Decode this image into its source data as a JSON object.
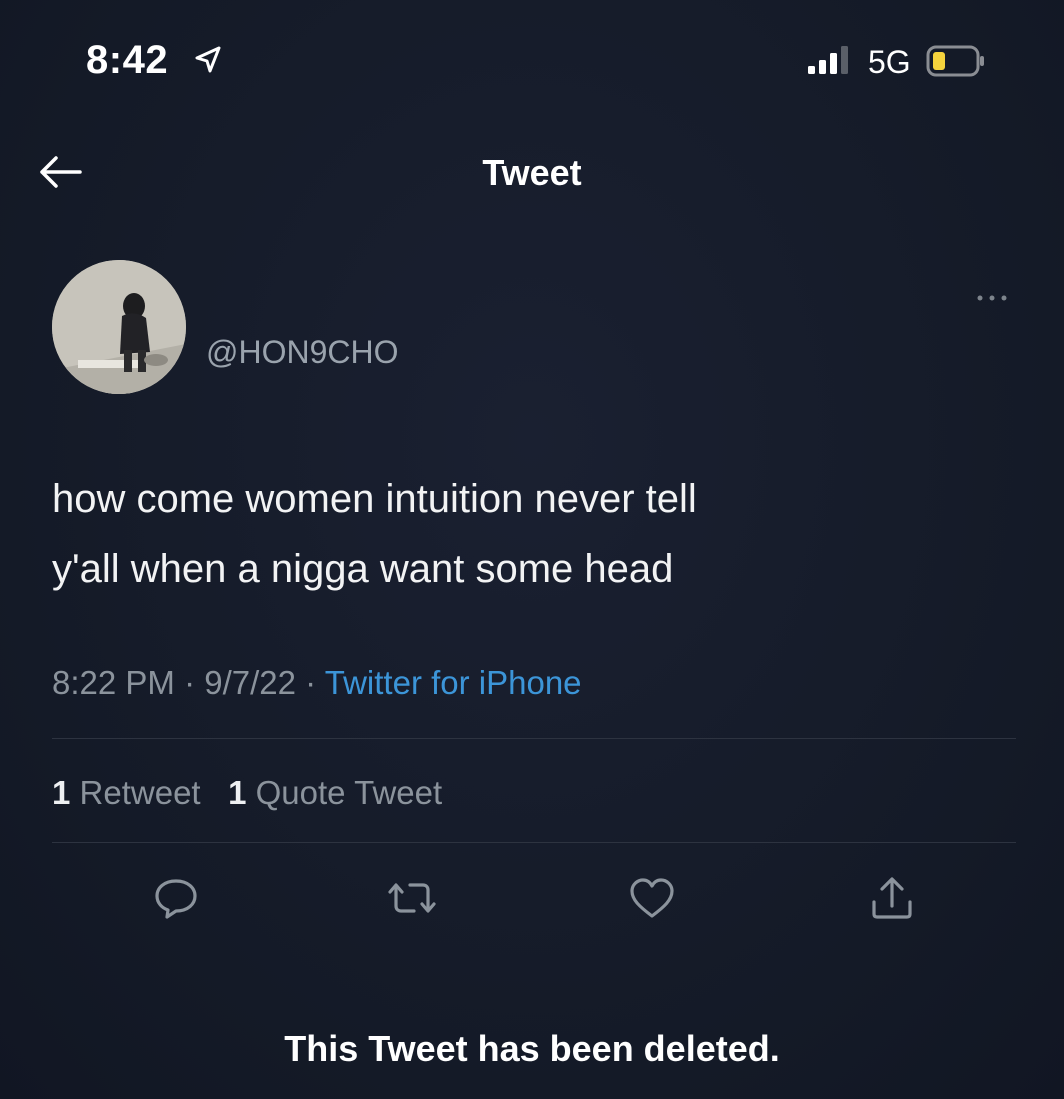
{
  "status_bar": {
    "time": "8:42",
    "network": "5G",
    "icons": [
      "location-arrow-icon",
      "signal-bars-icon",
      "battery-icon"
    ],
    "battery_color": "#f5d33d"
  },
  "header": {
    "title": "Tweet",
    "back_icon": "arrow-left-icon"
  },
  "author": {
    "handle": "@HON9CHO"
  },
  "tweet": {
    "text": "how come women intuition never tell\ny'all when a nigga want some head",
    "time": "8:22 PM",
    "date": "9/7/22",
    "separator": "·",
    "source": "Twitter for iPhone"
  },
  "stats": {
    "retweets_count": "1",
    "retweets_label": "Retweet",
    "quotes_count": "1",
    "quotes_label": "Quote Tweet"
  },
  "actions": [
    "reply-icon",
    "retweet-icon",
    "like-icon",
    "share-icon"
  ],
  "footer": {
    "message": "This Tweet has been deleted."
  },
  "colors": {
    "background": "#151b2a",
    "link": "#3c95d8",
    "muted": "#8b939c"
  }
}
